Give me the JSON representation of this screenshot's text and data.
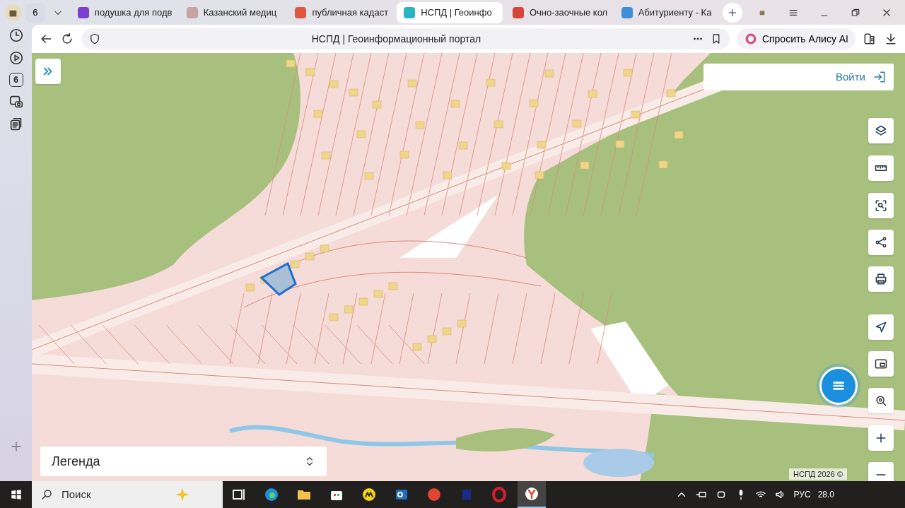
{
  "browser": {
    "tab_count": "6",
    "tabs": [
      {
        "title": "подушка для подв",
        "color": "#7b3fd1",
        "selected": false
      },
      {
        "title": "Казанский медиц",
        "color": "#c9a3a3",
        "selected": false
      },
      {
        "title": "публичная кадаст",
        "color": "#e0573f",
        "selected": false
      },
      {
        "title": "НСПД | Геоинфо",
        "color": "#2bb3c6",
        "selected": true
      },
      {
        "title": "Очно-заочные кол",
        "color": "#d8443a",
        "selected": false
      },
      {
        "title": "Абитуриенту - Ка",
        "color": "#3f8fd6",
        "selected": false
      }
    ],
    "page_title": "НСПД | Геоинформационный портал",
    "alice_button": "Спросить Алису AI"
  },
  "sidebar": {
    "tab_count": "6"
  },
  "map": {
    "login": "Войти",
    "legend": "Легенда",
    "copyright": "НСПД 2026 ©"
  },
  "taskbar": {
    "search_placeholder": "Поиск",
    "language": "РУС",
    "clock": "28.0"
  }
}
